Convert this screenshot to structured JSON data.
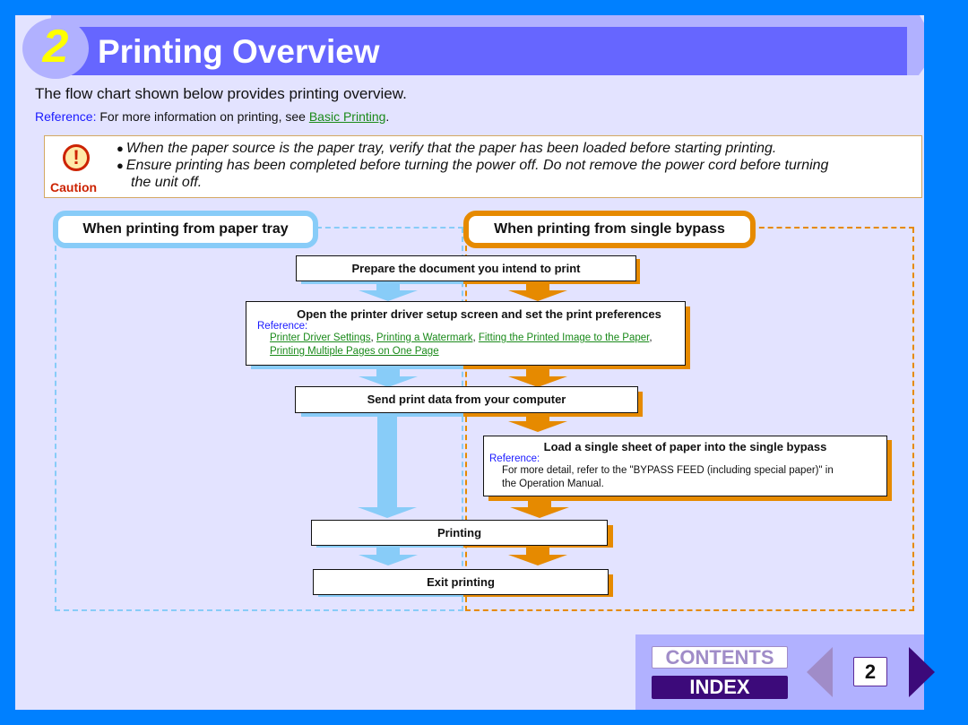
{
  "header": {
    "chapter_number": "2",
    "title": "Printing Overview"
  },
  "intro": "The flow chart shown below provides printing overview.",
  "reference": {
    "label": "Reference:",
    "text": " For more information on printing, see ",
    "link": "Basic Printing",
    "suffix": "."
  },
  "caution": {
    "icon": "exclamation-icon",
    "label": "Caution",
    "items": [
      "When the paper source is the paper tray, verify that the paper has been loaded before starting printing.",
      "Ensure printing has been completed before turning the power off. Do not remove the power cord before turning",
      "the unit off."
    ]
  },
  "flowchart": {
    "paper_tray_label": "When printing from paper tray",
    "bypass_label": "When printing from single bypass",
    "steps": [
      {
        "title": "Prepare the document you intend to print"
      },
      {
        "title": "Open the printer driver setup screen and set the print preferences",
        "reference_label": "Reference:",
        "links": [
          "Printer Driver Settings",
          "Printing a Watermark",
          "Fitting the Printed Image to the Paper",
          "Printing Multiple Pages on One Page"
        ]
      },
      {
        "title": "Send print data from your computer"
      },
      {
        "title": "Load a single sheet of paper into the single bypass",
        "reference_label": "Reference:",
        "reference_text_1": "For more detail, refer to the \"BYPASS FEED (including special paper)\" in",
        "reference_text_2": "the Operation Manual."
      },
      {
        "title": "Printing"
      },
      {
        "title": "Exit printing"
      }
    ],
    "colors": {
      "paper_tray": "#88ccf8",
      "bypass": "#e68a00"
    }
  },
  "nav": {
    "contents_label": "CONTENTS",
    "index_label": "INDEX",
    "page_number": "2",
    "prev_icon": "triangle-left-icon",
    "next_icon": "triangle-right-icon"
  },
  "colors": {
    "frame": "#0080ff",
    "page_bg": "#e3e3ff",
    "header_bar": "#6666ff",
    "header_accent": "#b1b1ff",
    "chapter_number": "#ffff00",
    "reference_label": "#1a1aff",
    "link": "#1a8a1a",
    "caution": "#cc2200",
    "index_bg": "#3c0a7a"
  }
}
